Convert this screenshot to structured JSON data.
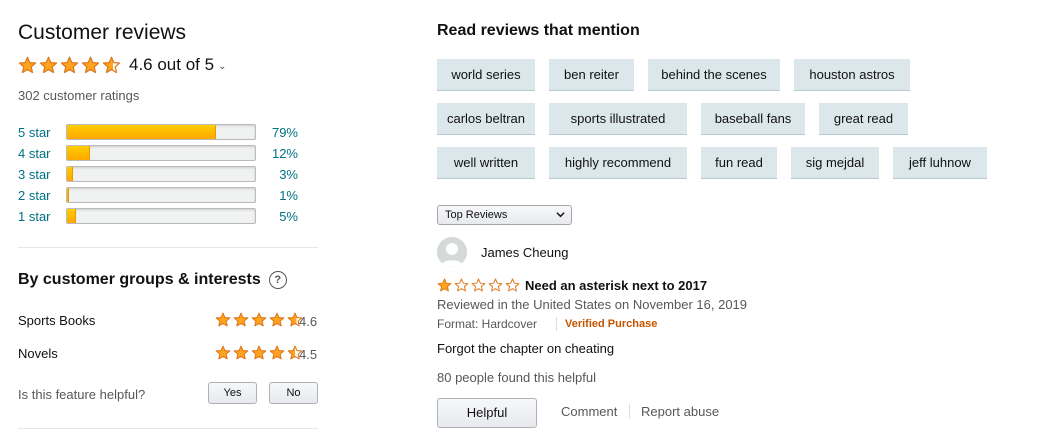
{
  "colors": {
    "star": "#ffa41c",
    "star_stroke": "#de7921",
    "link": "#007185",
    "chip_bg": "#dbe7ea",
    "verified": "#c45500"
  },
  "summary": {
    "title": "Customer reviews",
    "overall_text": "4.6 out of 5",
    "rating": 4.6,
    "ratings_count_text": "302 customer ratings",
    "histogram": [
      {
        "label": "5 star",
        "percent": 79,
        "percent_text": "79%"
      },
      {
        "label": "4 star",
        "percent": 12,
        "percent_text": "12%"
      },
      {
        "label": "3 star",
        "percent": 3,
        "percent_text": "3%"
      },
      {
        "label": "2 star",
        "percent": 1,
        "percent_text": "1%"
      },
      {
        "label": "1 star",
        "percent": 5,
        "percent_text": "5%"
      }
    ]
  },
  "groups": {
    "title": "By customer groups & interests",
    "help_icon": "?",
    "items": [
      {
        "name": "Sports Books",
        "rating": 4.6,
        "rating_text": "4.6"
      },
      {
        "name": "Novels",
        "rating": 4.5,
        "rating_text": "4.5"
      }
    ],
    "helpful_question": "Is this feature helpful?",
    "yes_label": "Yes",
    "no_label": "No"
  },
  "mentions": {
    "title": "Read reviews that mention",
    "chips": [
      "world series",
      "ben reiter",
      "behind the scenes",
      "houston astros",
      "carlos beltran",
      "sports illustrated",
      "baseball fans",
      "great read",
      "well written",
      "highly recommend",
      "fun read",
      "sig mejdal",
      "jeff luhnow"
    ]
  },
  "sort": {
    "selected": "Top Reviews"
  },
  "review": {
    "reviewer": "James Cheung",
    "rating": 1,
    "title": "Need an asterisk next to 2017",
    "date_text": "Reviewed in the United States on November 16, 2019",
    "format_text": "Format: Hardcover",
    "verified_text": "Verified Purchase",
    "body": "Forgot the chapter on cheating",
    "found_helpful": "80 people found this helpful",
    "helpful_label": "Helpful",
    "comment_label": "Comment",
    "report_label": "Report abuse"
  }
}
